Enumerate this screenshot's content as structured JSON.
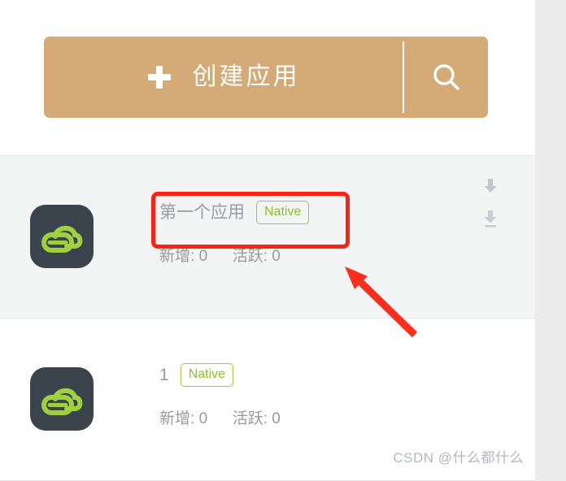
{
  "toolbar": {
    "create_label": "创建应用",
    "plus_icon": "plus-icon",
    "search_icon": "search-icon",
    "accent_color": "#d4aa76"
  },
  "apps": [
    {
      "icon": "cloud-app-icon",
      "title": "第一个应用",
      "badge": "Native",
      "stat_new_label": "新增:",
      "stat_new_value": "0",
      "stat_active_label": "活跃:",
      "stat_active_value": "0",
      "action_icons": [
        "arrow-down-icon",
        "download-icon"
      ]
    },
    {
      "icon": "cloud-app-icon",
      "title": "1",
      "badge": "Native",
      "stat_new_label": "新增:",
      "stat_new_value": "0",
      "stat_active_label": "活跃:",
      "stat_active_value": "0",
      "action_icons": []
    }
  ],
  "annotation": {
    "highlight_color": "#fc2113",
    "arrow_color": "#fc2f1c"
  },
  "watermark": {
    "text": "CSDN @什么都什么"
  }
}
